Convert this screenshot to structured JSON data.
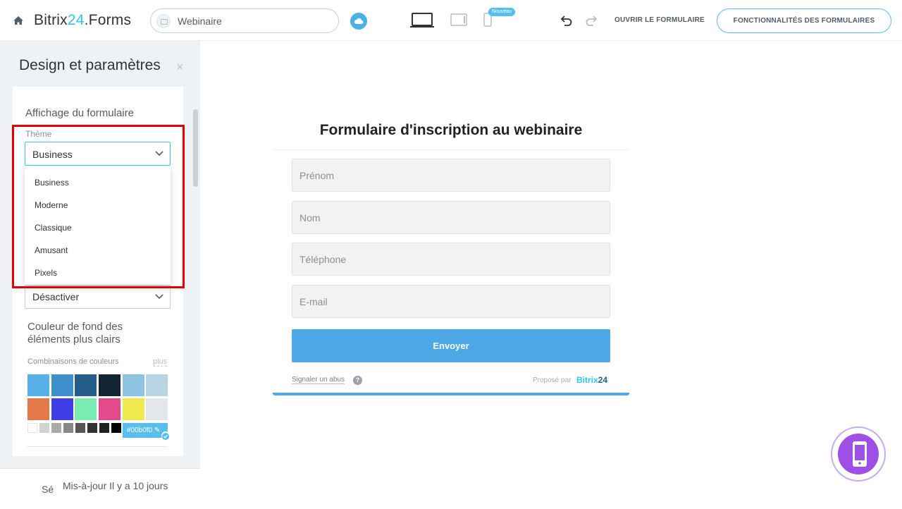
{
  "header": {
    "brand_prefix": "Bitrix",
    "brand_num": "24",
    "brand_suffix": ".Forms",
    "form_name": "Webinaire",
    "new_badge": "Nouveau",
    "open_form": "OUVRIR LE FORMULAIRE",
    "features": "FONCTIONNALITÉS DES FORMULAIRES"
  },
  "panel": {
    "title": "Design et paramètres",
    "close": "×",
    "section_title": "Affichage du formulaire",
    "theme_label": "Thème",
    "theme_value": "Business",
    "theme_options": [
      "Business",
      "Moderne",
      "Classique",
      "Amusant",
      "Pixels"
    ],
    "second_select_value": "Désactiver",
    "bg_title": "Couleur de fond des éléments plus clairs",
    "combos_label": "Combinaisons de couleurs",
    "more": "plus",
    "hex_value": "#00b0f0",
    "swatches_row1": [
      "#57b0e8",
      "#3e8fcc",
      "#245d87",
      "#112532",
      "#8cc3e0",
      "#b9d4e3"
    ],
    "swatches_row2": [
      "#e5784a",
      "#3f3de6",
      "#79ecb0",
      "#e34a8c",
      "#f0e94e",
      "#e4e7ea"
    ],
    "mini_swatches": [
      "#ffffff",
      "#d3d3d3",
      "#aaaaaa",
      "#888888",
      "#555555",
      "#333333",
      "#222222",
      "#000000"
    ],
    "footer_cut": "Sé",
    "footer_text": "Mis-à-jour Il y a 10 jours"
  },
  "form": {
    "title": "Formulaire d'inscription au webinaire",
    "fields": [
      "Prénom",
      "Nom",
      "Téléphone",
      "E-mail"
    ],
    "submit": "Envoyer",
    "report": "Signaler un abus",
    "help": "?",
    "powered_by": "Proposé par",
    "powered_brand": "Bitrix",
    "powered_num": "24"
  }
}
